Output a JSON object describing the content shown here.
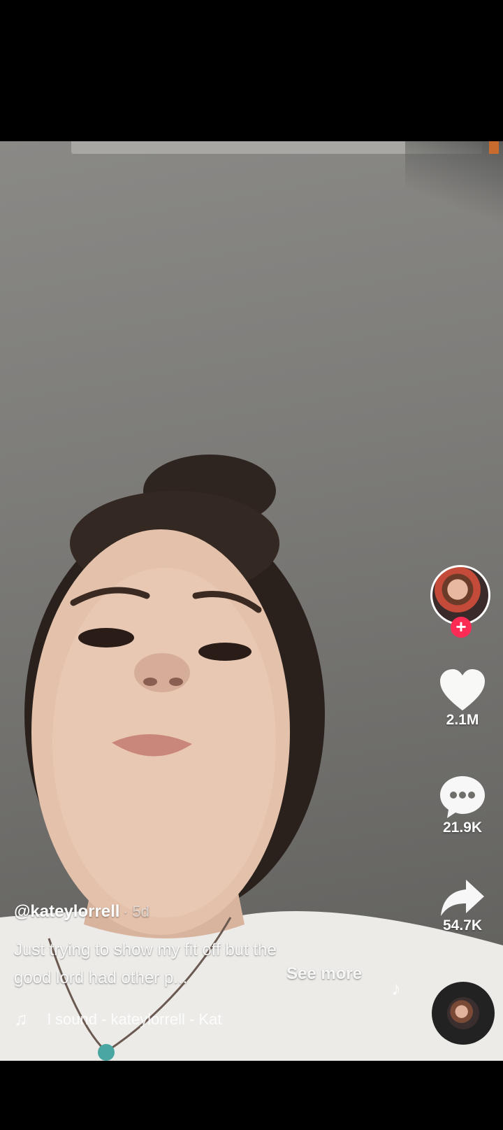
{
  "creator": {
    "username": "@kateylorrell",
    "time": "· 5d"
  },
  "caption": {
    "text_line1": "Just trying to show my fit off but the",
    "text_line2": "good lord had other p...",
    "see_more": "See more"
  },
  "sound": {
    "label": "l sound - kateylorrell - Kat"
  },
  "actions": {
    "likes": "2.1M",
    "comments": "21.9K",
    "shares": "54.7K"
  },
  "colors": {
    "accent": "#fe2c55",
    "text": "#ffffff"
  },
  "icons": {
    "like": "heart-icon",
    "comment": "comment-bubble-icon",
    "share": "share-arrow-icon",
    "sound": "music-note-icon",
    "follow": "plus-icon"
  }
}
